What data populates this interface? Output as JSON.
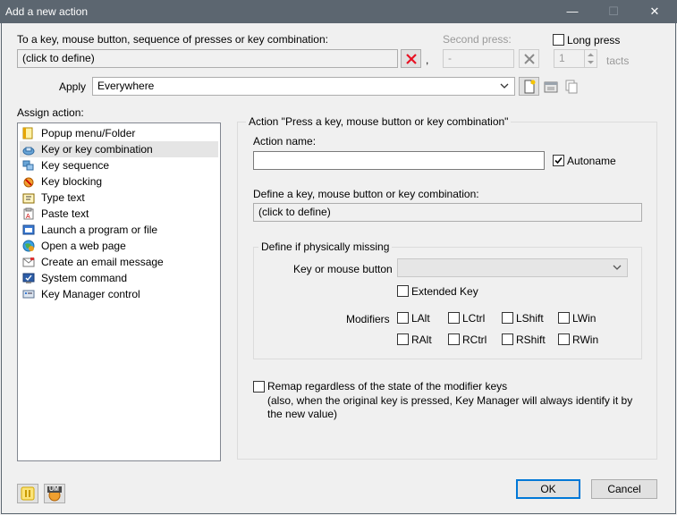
{
  "window": {
    "title": "Add a new action",
    "minimize_glyph": "—",
    "maximize_glyph": "☐",
    "close_glyph": "✕"
  },
  "trigger": {
    "label": "To a key, mouse button, sequence of presses or key combination:",
    "value": "(click to define)",
    "comma": ",",
    "second_press_label": "Second press:",
    "second_press_value": "-",
    "long_press_label": "Long press",
    "tacts_value": "1",
    "tacts_label": "tacts"
  },
  "apply": {
    "label": "Apply",
    "selected": "Everywhere"
  },
  "assign": {
    "label": "Assign action:",
    "items": [
      {
        "label": "Popup menu/Folder",
        "icon": "folder-icon"
      },
      {
        "label": "Key or key combination",
        "icon": "key-icon",
        "selected": true
      },
      {
        "label": "Key sequence",
        "icon": "key-sequence-icon"
      },
      {
        "label": "Key blocking",
        "icon": "key-blocking-icon"
      },
      {
        "label": "Type text",
        "icon": "type-text-icon"
      },
      {
        "label": "Paste text",
        "icon": "paste-text-icon"
      },
      {
        "label": "Launch a program or file",
        "icon": "launch-program-icon"
      },
      {
        "label": "Open a web page",
        "icon": "web-page-icon"
      },
      {
        "label": "Create an email message",
        "icon": "email-icon"
      },
      {
        "label": "System command",
        "icon": "system-command-icon"
      },
      {
        "label": "Key Manager control",
        "icon": "key-manager-icon"
      }
    ]
  },
  "action": {
    "group_title": "Action \"Press a key, mouse button or key combination\"",
    "name_label": "Action name:",
    "name_value": "",
    "autoname_label": "Autoname",
    "autoname_checked": true,
    "define_label": "Define a key, mouse button or key combination:",
    "define_value": "(click to define)",
    "missing": {
      "group_title": "Define if physically missing",
      "key_label": "Key or mouse button",
      "key_value": "",
      "extended_label": "Extended Key",
      "modifiers_label": "Modifiers",
      "modifiers": [
        "LAlt",
        "LCtrl",
        "LShift",
        "LWin",
        "RAlt",
        "RCtrl",
        "RShift",
        "RWin"
      ]
    },
    "remap_label": "Remap regardless of the state of the modifier keys",
    "remap_note_1": "(also, when the original key is pressed, Key Manager will always identify it by",
    "remap_note_2": "the new value)"
  },
  "buttons": {
    "ok": "OK",
    "cancel": "Cancel",
    "um_badge": "UM"
  },
  "colors": {
    "titlebar": "#5c6670",
    "selection": "#e5e5e5",
    "clear_red": "#e81123",
    "default_button_border": "#0078d7"
  }
}
